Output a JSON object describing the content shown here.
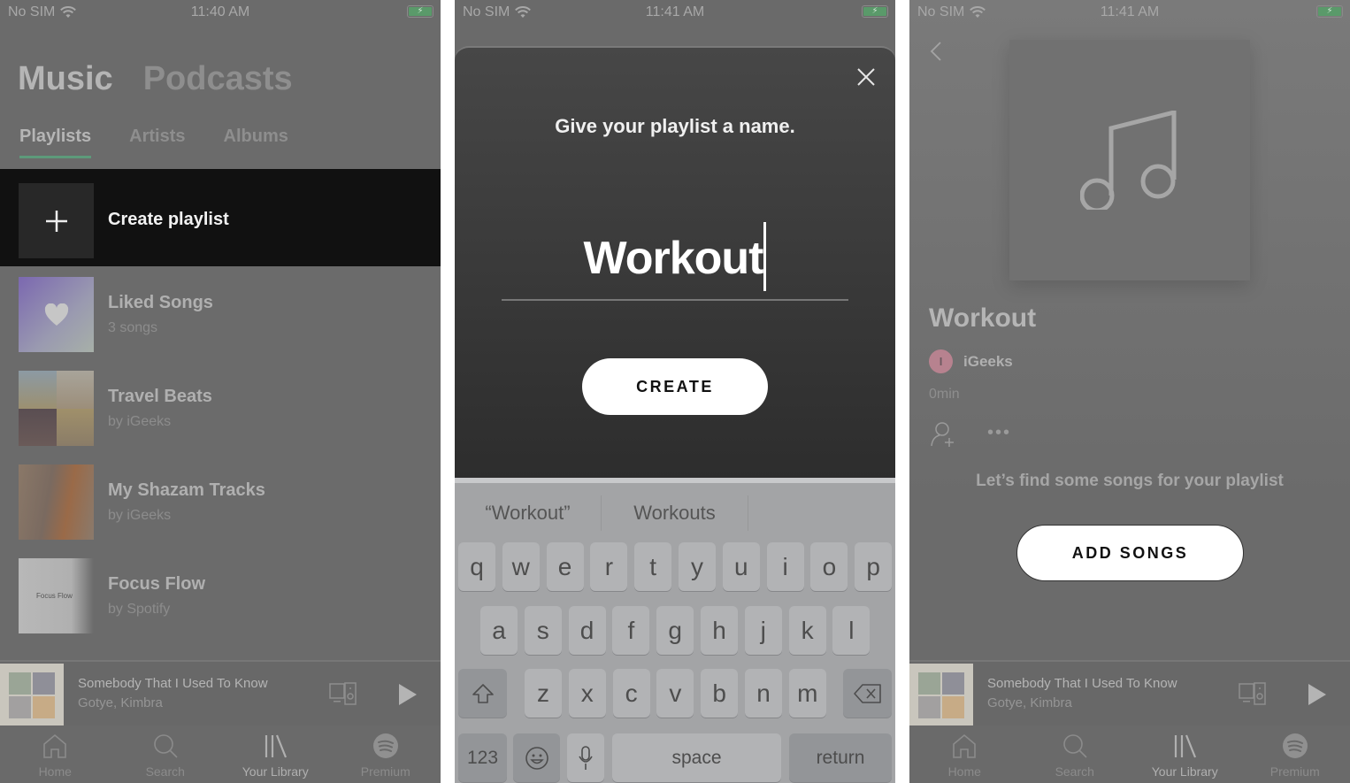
{
  "screens": [
    {
      "status": {
        "carrier": "No SIM",
        "time": "11:40 AM"
      },
      "main_tabs": [
        {
          "label": "Music",
          "active": true
        },
        {
          "label": "Podcasts",
          "active": false
        }
      ],
      "sub_tabs": [
        {
          "label": "Playlists",
          "active": true
        },
        {
          "label": "Artists",
          "active": false
        },
        {
          "label": "Albums",
          "active": false
        }
      ],
      "create_playlist_label": "Create playlist",
      "library_items": [
        {
          "title": "Liked Songs",
          "subtitle": "3 songs",
          "art": "heart-gradient"
        },
        {
          "title": "Travel Beats",
          "subtitle": "by iGeeks",
          "art": "mosaic"
        },
        {
          "title": "My Shazam Tracks",
          "subtitle": "by iGeeks",
          "art": "photo"
        },
        {
          "title": "Focus Flow",
          "subtitle": "by Spotify",
          "art": "photo",
          "art_caption": "Focus Flow"
        }
      ]
    },
    {
      "status": {
        "carrier": "No SIM",
        "time": "11:41 AM"
      },
      "dialog": {
        "prompt": "Give your playlist a name.",
        "name_value": "Workout",
        "create_label": "CREATE",
        "close_icon": "close-icon"
      },
      "keyboard": {
        "suggestions": [
          "“Workout”",
          "Workouts",
          ""
        ],
        "row1": [
          "q",
          "w",
          "e",
          "r",
          "t",
          "y",
          "u",
          "i",
          "o",
          "p"
        ],
        "row2": [
          "a",
          "s",
          "d",
          "f",
          "g",
          "h",
          "j",
          "k",
          "l"
        ],
        "row3": [
          "z",
          "x",
          "c",
          "v",
          "b",
          "n",
          "m"
        ],
        "numbers_label": "123",
        "space_label": "space",
        "return_label": "return"
      }
    },
    {
      "status": {
        "carrier": "No SIM",
        "time": "11:41 AM"
      },
      "playlist": {
        "title": "Workout",
        "owner_initial": "I",
        "owner": "iGeeks",
        "duration": "0min",
        "more_label": "•••",
        "empty_message": "Let’s find some songs for your playlist",
        "add_songs_label": "ADD SONGS"
      }
    }
  ],
  "now_playing": {
    "song": "Somebody That I Used To Know",
    "artist": "Gotye, Kimbra"
  },
  "bottom_nav": [
    {
      "label": "Home",
      "icon": "home-icon",
      "active": false
    },
    {
      "label": "Search",
      "icon": "search-icon",
      "active": false
    },
    {
      "label": "Your Library",
      "icon": "library-icon",
      "active": true
    },
    {
      "label": "Premium",
      "icon": "spotify-icon",
      "active": false
    }
  ],
  "colors": {
    "accent_tab_underline": "#5d9a7a",
    "battery": "#5a9a6a",
    "avatar": "#b7828f"
  }
}
